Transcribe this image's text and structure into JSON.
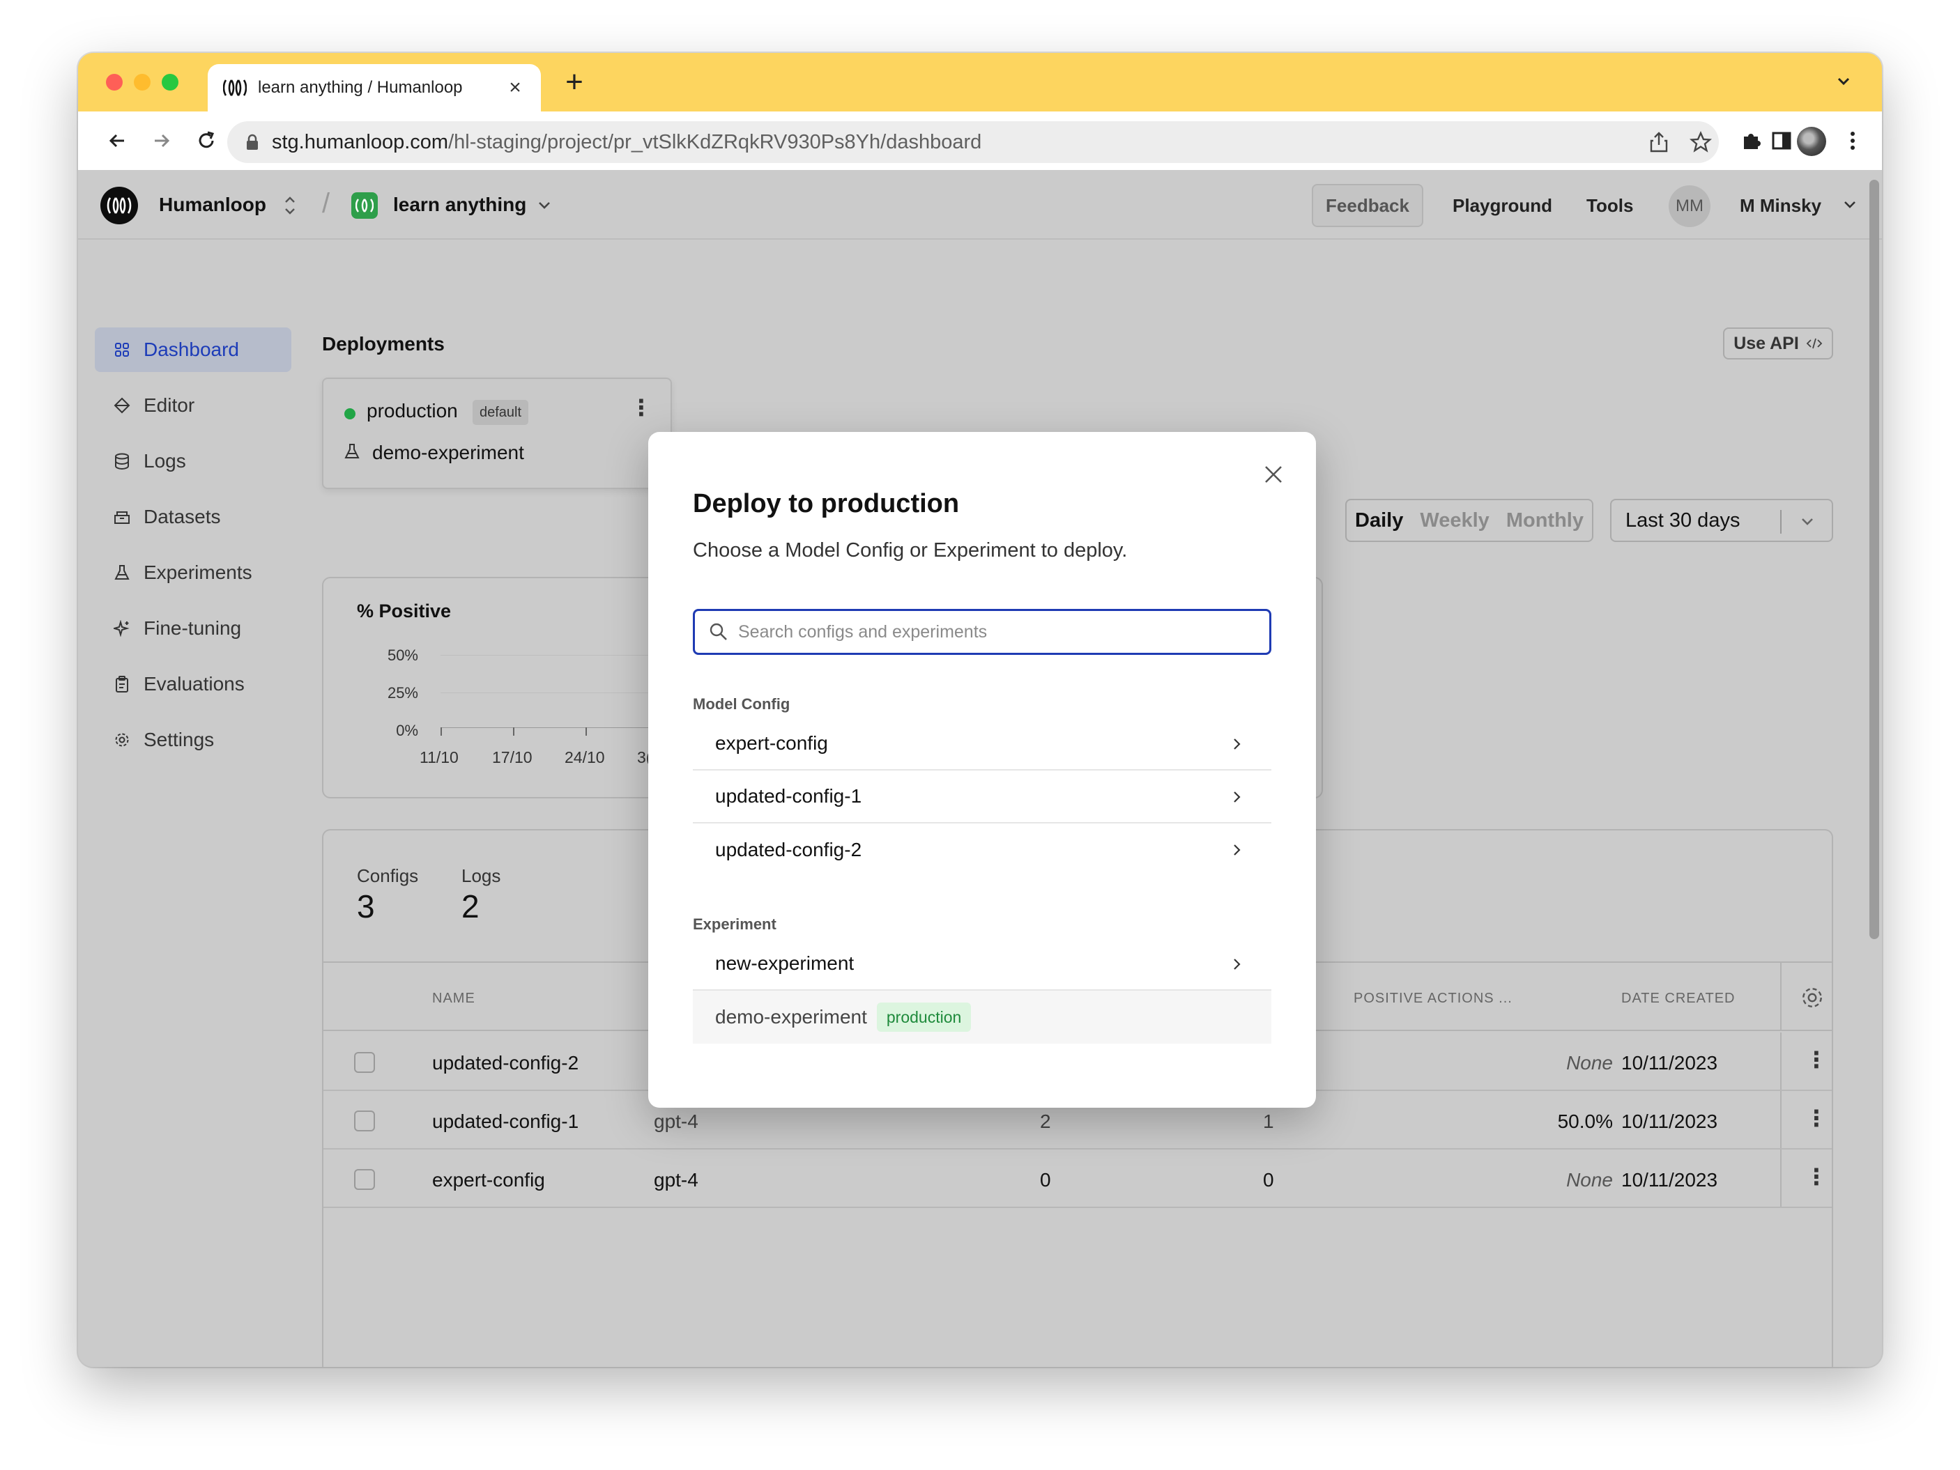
{
  "browser": {
    "tab_title": "learn anything / Humanloop",
    "url_host": "stg.humanloop.com",
    "url_path": "/hl-staging/project/pr_vtSlkKdZRqkRV930Ps8Yh/dashboard"
  },
  "header": {
    "org_name": "Humanloop",
    "project_name": "learn anything",
    "feedback_label": "Feedback",
    "playground_label": "Playground",
    "tools_label": "Tools",
    "user_initials": "MM",
    "user_name": "M Minsky"
  },
  "sidebar": {
    "items": [
      {
        "label": "Dashboard",
        "icon": "grid-icon",
        "active": true
      },
      {
        "label": "Editor",
        "icon": "diamond-icon"
      },
      {
        "label": "Logs",
        "icon": "database-icon"
      },
      {
        "label": "Datasets",
        "icon": "box-icon"
      },
      {
        "label": "Experiments",
        "icon": "flask-icon"
      },
      {
        "label": "Fine-tuning",
        "icon": "sparkle-icon"
      },
      {
        "label": "Evaluations",
        "icon": "clipboard-icon"
      },
      {
        "label": "Settings",
        "icon": "gear-icon"
      }
    ]
  },
  "deployments": {
    "title": "Deployments",
    "use_api_label": "Use API",
    "env_name": "production",
    "env_badge": "default",
    "deployed_item": "demo-experiment"
  },
  "filters": {
    "daily": "Daily",
    "weekly": "Weekly",
    "monthly": "Monthly",
    "range": "Last 30 days"
  },
  "chart": {
    "title": "% Positive",
    "y_ticks": [
      "50%",
      "25%",
      "0%"
    ],
    "x_ticks": [
      "11/10",
      "17/10",
      "24/10",
      "3("
    ]
  },
  "stats": {
    "configs_label": "Configs",
    "configs_value": "3",
    "logs_label": "Logs",
    "logs_value": "2"
  },
  "table": {
    "columns": [
      "NAME",
      "POSITIVE ACTIONS ...",
      "DATE CREATED"
    ],
    "rows": [
      {
        "name": "updated-config-2",
        "model": "",
        "c1": "",
        "c2": "",
        "positive": "None",
        "date": "10/11/2023"
      },
      {
        "name": "updated-config-1",
        "model": "gpt-4",
        "c1": "2",
        "c2": "1",
        "positive": "50.0%",
        "date": "10/11/2023"
      },
      {
        "name": "expert-config",
        "model": "gpt-4",
        "c1": "0",
        "c2": "0",
        "positive": "None",
        "date": "10/11/2023"
      }
    ]
  },
  "modal": {
    "title": "Deploy to production",
    "subtitle": "Choose a Model Config or Experiment to deploy.",
    "search_placeholder": "Search configs and experiments",
    "model_config_label": "Model Config",
    "model_configs": [
      "expert-config",
      "updated-config-1",
      "updated-config-2"
    ],
    "experiment_label": "Experiment",
    "experiments": [
      "new-experiment",
      "demo-experiment"
    ],
    "current_badge": "production"
  }
}
